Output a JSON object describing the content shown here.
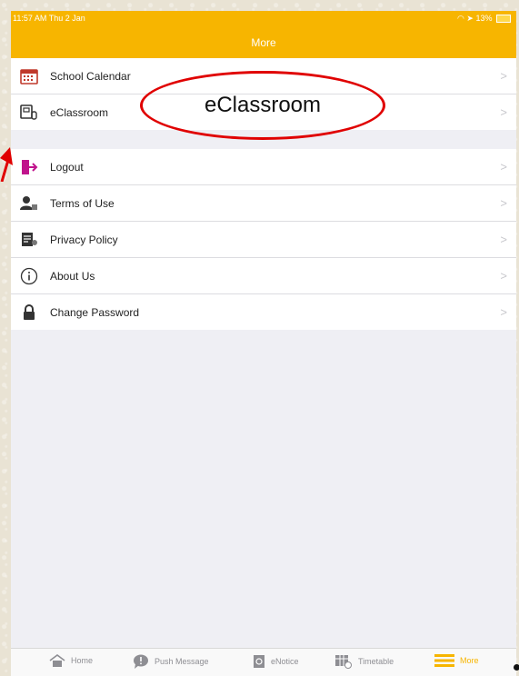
{
  "status_bar": {
    "time_date": "11:57 AM  Thu 2 Jan",
    "battery": "13%"
  },
  "nav": {
    "title": "More"
  },
  "menu_group_1": [
    {
      "label": "School Calendar",
      "icon": "calendar-icon",
      "icon_color": "#c0392b"
    },
    {
      "label": "eClassroom",
      "icon": "eclassroom-icon",
      "icon_color": "#333333"
    }
  ],
  "menu_group_2": [
    {
      "label": "Logout",
      "icon": "logout-icon",
      "icon_color": "#c0138c"
    },
    {
      "label": "Terms of Use",
      "icon": "terms-icon",
      "icon_color": "#333333"
    },
    {
      "label": "Privacy Policy",
      "icon": "privacy-icon",
      "icon_color": "#333333"
    },
    {
      "label": "About Us",
      "icon": "info-icon",
      "icon_color": "#333333"
    },
    {
      "label": "Change Password",
      "icon": "lock-icon",
      "icon_color": "#333333"
    }
  ],
  "chevron": ">",
  "annotation": {
    "text": "eClassroom",
    "color": "#e00000"
  },
  "tabs": [
    {
      "label": "Home",
      "icon": "home-icon"
    },
    {
      "label": "Push Message",
      "icon": "push-message-icon"
    },
    {
      "label": "eNotice",
      "icon": "enotice-icon"
    },
    {
      "label": "Timetable",
      "icon": "timetable-icon"
    },
    {
      "label": "More",
      "icon": "more-icon",
      "active": true
    }
  ],
  "accent_color": "#f7b500"
}
